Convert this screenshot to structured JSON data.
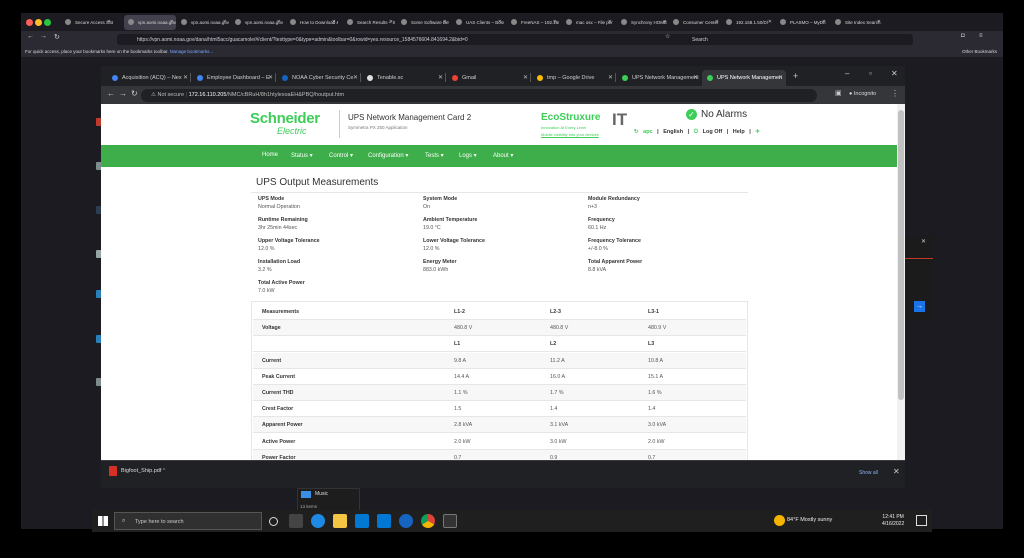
{
  "firefox": {
    "tabs": [
      "Secure Access SSL",
      "vpn.aomi.noaa.gov/",
      "vpn.aomi.noaa.gov",
      "vpn.aomi.noaa.gov",
      "How to Download & K",
      "Search Results – Ser",
      "Some Software Beta D",
      "UAS Clients – Boss",
      "FreeNAS – 192.168",
      "mac osx – File per",
      "Synchrony HOME",
      "Consumer Center",
      "192.168.1.50/Dl",
      "PLASMO – MyDri",
      "Site Index Search"
    ],
    "url": "https://vpn.aomi.noaa.gov/dana/html5acc/guacamole/#/client/?testtype=0&type=admin&toolbar=0&rowid=yes.resource_1584576604.841694.2&bid=0",
    "search_placeholder": "Search",
    "bookmarks_text": "For quick access, place your bookmarks here on the bookmarks toolbar.",
    "bookmarks_link": "Manage bookmarks...",
    "other_bookmarks": "Other Bookmarks"
  },
  "chrome": {
    "tabs": [
      "Acquisition (ACQ) – Nex",
      "Employee Dashboard – E",
      "NOAA Cyber Security Ce",
      "Tenable.sc",
      "Gmail",
      "tmp – Google Drive",
      "UPS Network Management",
      "UPS Network Managemen"
    ],
    "new_tab": "+",
    "security": "Not secure",
    "url_host": "172.16.110.205",
    "url_path": "/NMC/cBRuH/8h1htylexoaEH&PBQ/houtput.htm",
    "profile": "Incognito"
  },
  "page": {
    "brand_name": "Schneider",
    "brand_sub": "Electric",
    "product_title": "UPS Network Management Card 2",
    "product_subtitle": "Symmetra PX 250 Application",
    "eco": "EcoStruxure",
    "eco_tag": "Innovation At Every Level",
    "eco_link": "Mobile visibility into your devices",
    "it": "IT",
    "alarm": "No Alarms",
    "user": {
      "apc": "apc",
      "lang": "English",
      "logoff": "Log Off",
      "help": "Help"
    },
    "menu": [
      "Home",
      "Status ▾",
      "Control ▾",
      "Configuration ▾",
      "Tests ▾",
      "Logs ▾",
      "About ▾"
    ],
    "title": "UPS Output Measurements",
    "summary": [
      {
        "label": "UPS Mode",
        "value": "Normal Operation"
      },
      {
        "label": "System Mode",
        "value": "On"
      },
      {
        "label": "Module Redundancy",
        "value": "n+3"
      },
      {
        "label": "Runtime Remaining",
        "value": "3hr 25min 44sec"
      },
      {
        "label": "Ambient Temperature",
        "value": "19.0 °C"
      },
      {
        "label": "Frequency",
        "value": "60.1 Hz"
      },
      {
        "label": "Upper Voltage Tolerance",
        "value": "12.0 %"
      },
      {
        "label": "Lower Voltage Tolerance",
        "value": "12.0 %"
      },
      {
        "label": "Frequency Tolerance",
        "value": "+/-8.0 %"
      },
      {
        "label": "Installation Load",
        "value": "3.2 %"
      },
      {
        "label": "Energy Meter",
        "value": "883.0 kWh"
      },
      {
        "label": "Total Apparent Power",
        "value": "8.8 kVA"
      },
      {
        "label": "Total Active Power",
        "value": "7.0 kW"
      }
    ],
    "measurements": [
      {
        "c": [
          "Measurements",
          "L1-2",
          "L2-3",
          "L3-1"
        ],
        "head": true
      },
      {
        "c": [
          "Voltage",
          "480.8 V",
          "480.8 V",
          "480.9 V"
        ]
      },
      {
        "c": [
          "",
          "L1",
          "L2",
          "L3"
        ],
        "head": true
      },
      {
        "c": [
          "Current",
          "9.8 A",
          "11.2 A",
          "10.8 A"
        ]
      },
      {
        "c": [
          "Peak Current",
          "14.4 A",
          "16.0 A",
          "15.1 A"
        ]
      },
      {
        "c": [
          "Current THD",
          "1.1 %",
          "1.7 %",
          "1.6 %"
        ]
      },
      {
        "c": [
          "Crest Factor",
          "1.5",
          "1.4",
          "1.4"
        ]
      },
      {
        "c": [
          "Apparent Power",
          "2.8 kVA",
          "3.1 kVA",
          "3.0 kVA"
        ]
      },
      {
        "c": [
          "Active Power",
          "2.0 kW",
          "3.0 kW",
          "2.0 kW"
        ]
      },
      {
        "c": [
          "Power Factor",
          "0.7",
          "0.9",
          "0.7"
        ]
      }
    ]
  },
  "download": {
    "file": "Bigfoot_Ship.pdf",
    "show_all": "Show all"
  },
  "music": {
    "title": "Music",
    "items": "13 items"
  },
  "taskbar": {
    "search": "Type here to search",
    "weather": "84°F  Mostly sunny",
    "time": "12:41 PM",
    "date": "4/16/2022"
  },
  "colors": {
    "schneider_green": "#3dcd58",
    "menu_green": "#3dae49"
  }
}
